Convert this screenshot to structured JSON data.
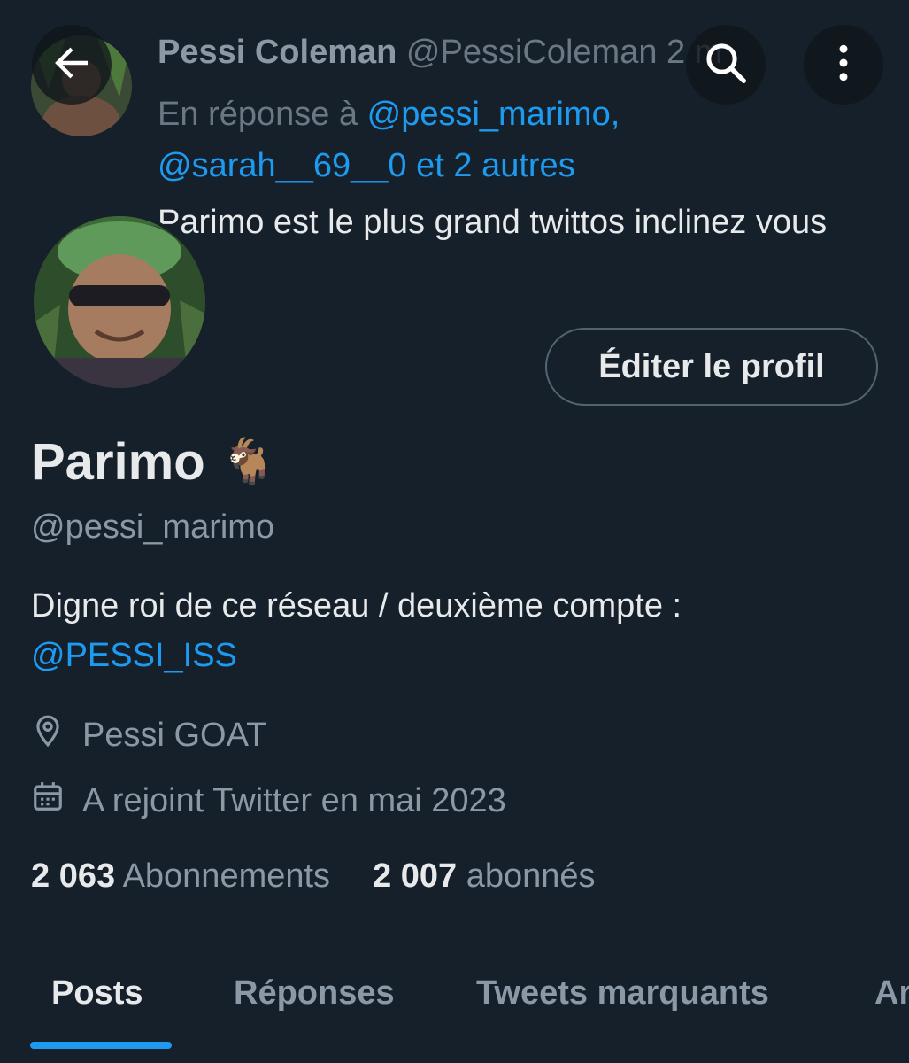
{
  "tweet": {
    "author_name": "Pessi Coleman",
    "author_handle": "@PessiColeman",
    "time": "2 m",
    "reply_prefix": "En réponse à",
    "reply_mention_1": "@pessi_marimo,",
    "reply_mention_2": "@sarah__69__0",
    "reply_suffix": "et 2 autres",
    "text": "Parimo est le plus grand twittos inclinez vous"
  },
  "nav": {
    "back_icon": "back-arrow-icon",
    "search_icon": "search-icon",
    "more_icon": "more-vertical-icon"
  },
  "profile": {
    "edit_button": "Éditer le profil",
    "display_name": "Parimo",
    "emoji": "🐐",
    "handle": "@pessi_marimo",
    "bio_text": "Digne roi de ce réseau / deuxième compte :",
    "bio_mention": "@PESSI_ISS",
    "location": "Pessi GOAT",
    "joined": "A rejoint Twitter en mai 2023",
    "following_count": "2 063",
    "following_label": "Abonnements",
    "followers_count": "2 007",
    "followers_label": "abonnés"
  },
  "tabs": [
    {
      "label": "Posts",
      "active": true
    },
    {
      "label": "Réponses",
      "active": false
    },
    {
      "label": "Tweets marquants",
      "active": false
    },
    {
      "label": "Ar",
      "active": false
    }
  ],
  "colors": {
    "background": "#15202b",
    "accent": "#1d9bf0",
    "secondary_text": "#8b98a5"
  }
}
